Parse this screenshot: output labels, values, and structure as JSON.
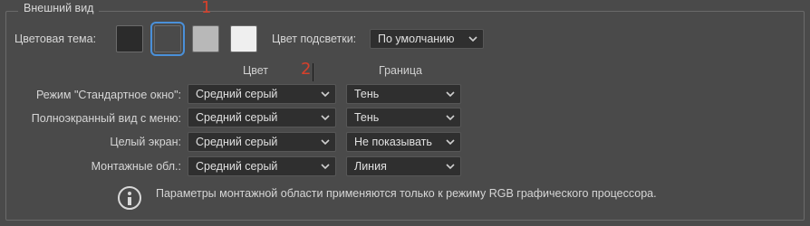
{
  "panel": {
    "title": "Внешний вид"
  },
  "theme": {
    "label": "Цветовая тема:",
    "swatches": [
      {
        "name": "dark",
        "color": "#2b2b2b",
        "selected": false
      },
      {
        "name": "medium-dark",
        "color": "#4a4a4a",
        "selected": true
      },
      {
        "name": "medium-light",
        "color": "#b8b8b8",
        "selected": false
      },
      {
        "name": "light",
        "color": "#efefef",
        "selected": false
      }
    ]
  },
  "highlight": {
    "label": "Цвет подсветки:",
    "value": "По умолчанию"
  },
  "columns": {
    "color": "Цвет",
    "border": "Граница"
  },
  "rows": [
    {
      "label": "Режим \"Стандартное окно\":",
      "color": "Средний серый",
      "border": "Тень"
    },
    {
      "label": "Полноэкранный вид с меню:",
      "color": "Средний серый",
      "border": "Тень"
    },
    {
      "label": "Целый экран:",
      "color": "Средний серый",
      "border": "Не показывать"
    },
    {
      "label": "Монтажные обл.:",
      "color": "Средний серый",
      "border": "Линия"
    }
  ],
  "info": {
    "text": "Параметры монтажной области применяются только к режиму RGB графического процессора."
  },
  "annotations": {
    "one": "1",
    "two": "2"
  },
  "accent": "#4a90d9",
  "annotation_color": "#d7402b"
}
